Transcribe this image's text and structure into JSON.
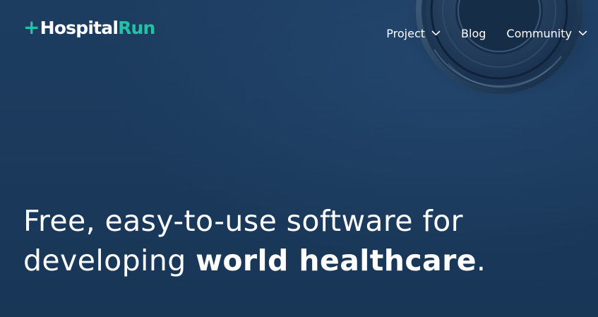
{
  "header": {
    "logo": {
      "part1": "Hospital",
      "part2": "Run",
      "plus_symbol": "+",
      "plus_icon": "plus-icon"
    },
    "nav": [
      {
        "label": "Project",
        "has_dropdown": true,
        "icon": "chevron-down-icon"
      },
      {
        "label": "Blog",
        "has_dropdown": false
      },
      {
        "label": "Community",
        "has_dropdown": true,
        "icon": "chevron-down-icon"
      }
    ]
  },
  "hero": {
    "line1": "Free, easy-to-use software for",
    "line2_prefix": "developing ",
    "line2_bold": "world healthcare",
    "line2_suffix": ".",
    "background_image": "stethoscope-image"
  },
  "colors": {
    "background": "#1b3a5c",
    "brand_accent": "#21c3a4",
    "text": "#ffffff"
  }
}
